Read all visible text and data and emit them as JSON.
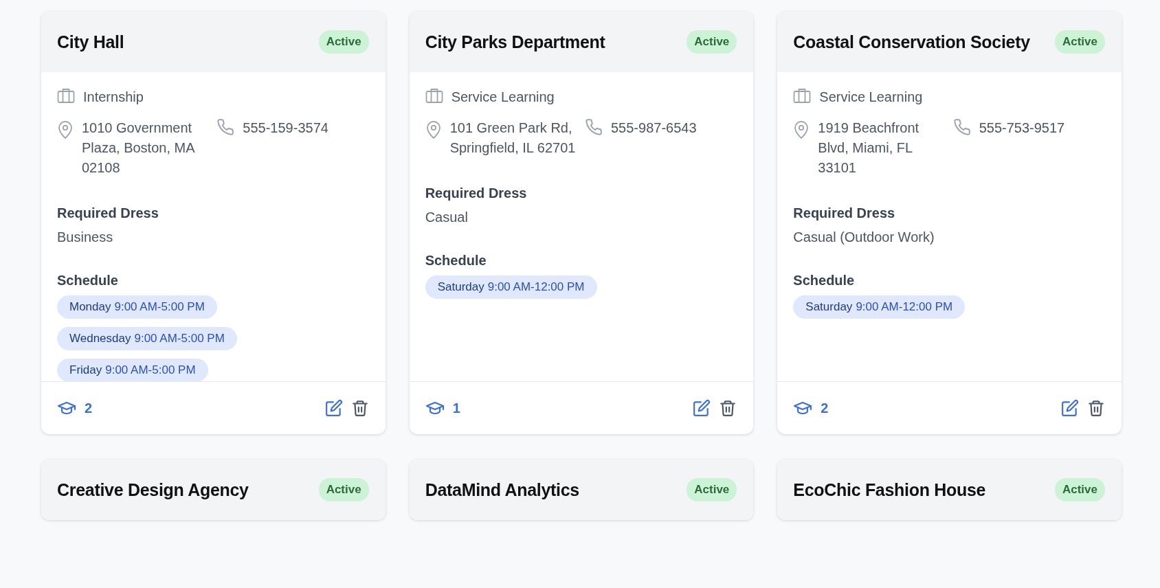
{
  "cards": [
    {
      "title": "City Hall",
      "status": "Active",
      "type": "Internship",
      "address": "1010 Government Plaza, Boston, MA 02108",
      "phone": "555-159-3574",
      "dress_label": "Required Dress",
      "dress": "Business",
      "schedule_label": "Schedule",
      "schedule": [
        {
          "day": "Monday",
          "time": "9:00 AM-5:00 PM"
        },
        {
          "day": "Wednesday",
          "time": "9:00 AM-5:00 PM"
        },
        {
          "day": "Friday",
          "time": "9:00 AM-5:00 PM"
        }
      ],
      "students": "2"
    },
    {
      "title": "City Parks Department",
      "status": "Active",
      "type": "Service Learning",
      "address": "101 Green Park Rd, Springfield, IL 62701",
      "phone": "555-987-6543",
      "dress_label": "Required Dress",
      "dress": "Casual",
      "schedule_label": "Schedule",
      "schedule": [
        {
          "day": "Saturday",
          "time": "9:00 AM-12:00 PM"
        }
      ],
      "students": "1"
    },
    {
      "title": "Coastal Conservation Society",
      "status": "Active",
      "type": "Service Learning",
      "address": "1919 Beachfront Blvd, Miami, FL 33101",
      "phone": "555-753-9517",
      "dress_label": "Required Dress",
      "dress": "Casual (Outdoor Work)",
      "schedule_label": "Schedule",
      "schedule": [
        {
          "day": "Saturday",
          "time": "9:00 AM-12:00 PM"
        }
      ],
      "students": "2"
    },
    {
      "title": "Creative Design Agency",
      "status": "Active"
    },
    {
      "title": "DataMind Analytics",
      "status": "Active"
    },
    {
      "title": "EcoChic Fashion House",
      "status": "Active"
    }
  ]
}
